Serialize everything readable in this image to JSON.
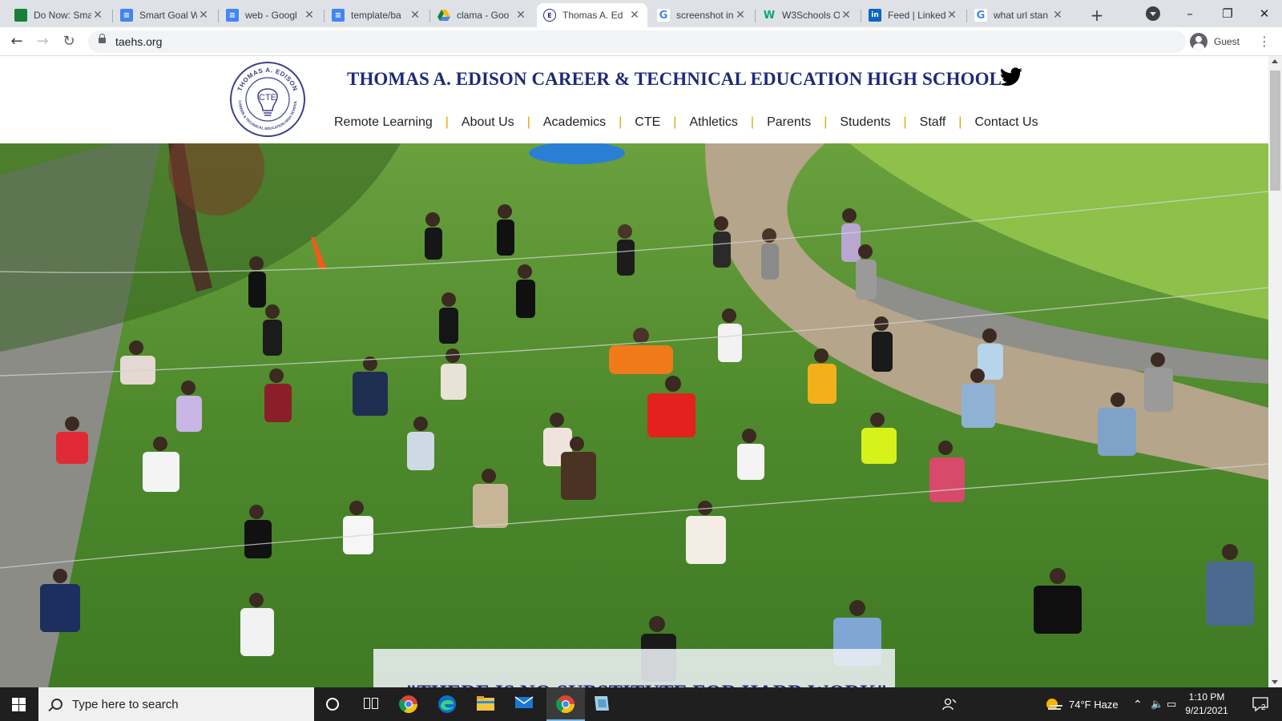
{
  "browser": {
    "tabs": [
      {
        "title": "Do Now: Sma",
        "favicon": "google-classroom-icon",
        "color": "#188038"
      },
      {
        "title": "Smart Goal W",
        "favicon": "google-docs-icon",
        "color": "#4285f4"
      },
      {
        "title": "web - Googl",
        "favicon": "google-docs-icon",
        "color": "#4285f4"
      },
      {
        "title": "template/ba",
        "favicon": "google-docs-icon",
        "color": "#4285f4"
      },
      {
        "title": "clama - Goo",
        "favicon": "google-drive-icon",
        "color": "#fbbc04"
      },
      {
        "title": "Thomas A. Ed",
        "favicon": "edison-logo-icon",
        "color": "#1f2a7a"
      },
      {
        "title": "screenshot in",
        "favicon": "google-icon",
        "color": "#4285f4"
      },
      {
        "title": "W3Schools O",
        "favicon": "w3schools-icon",
        "color": "#04aa6d"
      },
      {
        "title": "Feed | Linked",
        "favicon": "linkedin-icon",
        "color": "#0a66c2"
      },
      {
        "title": "what url stan",
        "favicon": "google-icon",
        "color": "#4285f4"
      }
    ],
    "active_tab": 5,
    "new_tab_symbol": "+",
    "url": "taehs.org",
    "profile_label": "Guest"
  },
  "site": {
    "title": "THOMAS A. EDISON CAREER & TECHNICAL EDUCATION HIGH SCHOOL",
    "logo_text_top": "THOMAS A. EDISON",
    "logo_text_bottom": "CAREER & TECHNICAL EDUCATION HIGH SCHOOL",
    "logo_center": "CTE",
    "nav": [
      "Remote Learning",
      "About Us",
      "Academics",
      "CTE",
      "Athletics",
      "Parents",
      "Students",
      "Staff",
      "Contact Us"
    ],
    "nav_separator": "|",
    "hero_quote": "\"THERE IS NO SUBSTITUTE FOR HARD WORK\"",
    "brand_color": "#1f2a7a",
    "accent_color": "#d9a400"
  },
  "taskbar": {
    "search_placeholder": "Type here to search",
    "weather": "74°F  Haze",
    "time": "1:10 PM",
    "date": "9/21/2021",
    "notification_count": "2"
  }
}
